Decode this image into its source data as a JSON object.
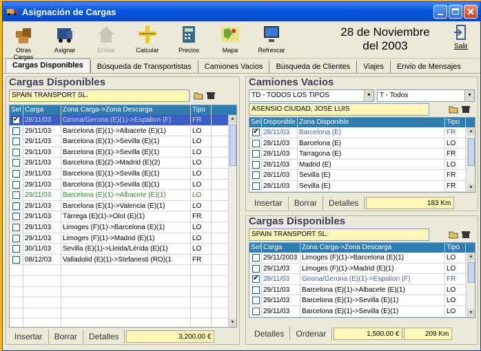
{
  "window": {
    "title": "Asignación de Cargas"
  },
  "toolbar": {
    "items": [
      {
        "label": "Otras Cargas",
        "icon": "boxes-icon"
      },
      {
        "label": "Asignar",
        "icon": "truck-icon"
      },
      {
        "label": "Enviar",
        "icon": "house-icon",
        "disabled": true
      },
      {
        "label": "Calcular",
        "icon": "ruler-icon"
      },
      {
        "label": "Precios",
        "icon": "calculator-icon"
      },
      {
        "label": "Mapa",
        "icon": "map-icon"
      },
      {
        "label": "Refrescar",
        "icon": "monitor-icon"
      }
    ],
    "date_line1": "28 de Noviembre",
    "date_line2": "del 2003",
    "exit_label": "Salir"
  },
  "tabs": [
    {
      "label": "Cargas Disponibles",
      "active": true
    },
    {
      "label": "Búsqueda de Transportistas"
    },
    {
      "label": "Camiones Vacios"
    },
    {
      "label": "Búsqueda de Clientes"
    },
    {
      "label": "Viajes"
    },
    {
      "label": "Envio de Mensajes"
    }
  ],
  "left_panel": {
    "title": "Cargas Disponibles",
    "company": "SPAIN TRANSPORT SL.",
    "columns": [
      "Sel",
      "Carga",
      "Zona Carga->Zona Descarga",
      "Tipo"
    ],
    "rows": [
      {
        "sel": true,
        "date": "28/11/03",
        "zone": "Girona/Gerona  (E)(1)->Espalion  (F)",
        "type": "FR",
        "style": "first"
      },
      {
        "sel": false,
        "date": "29/11/03",
        "zone": "Barcelona  (E)(1)->Albacete  (E)(1)",
        "type": "LO"
      },
      {
        "sel": false,
        "date": "29/11/03",
        "zone": "Barcelona  (E)(1)->Sevilla  (E)(1)",
        "type": "LO"
      },
      {
        "sel": false,
        "date": "29/11/03",
        "zone": "Barcelona  (E)(1)->Sevilla  (E)(1)",
        "type": "LO"
      },
      {
        "sel": false,
        "date": "29/11/03",
        "zone": "Barcelona  (E)(2)->Madrid  (E)(2)",
        "type": "LO"
      },
      {
        "sel": false,
        "date": "29/11/03",
        "zone": "Barcelona  (E)(1)->Sevilla  (E)(1)",
        "type": "LO"
      },
      {
        "sel": false,
        "date": "29/11/03",
        "zone": "Barcelona  (E)(1)->Sevilla  (E)(1)",
        "type": "LO"
      },
      {
        "sel": false,
        "date": "29/11/03",
        "zone": "Barcelona  (E)(1)->Albacete  (E)(1)",
        "type": "LO",
        "style": "hl"
      },
      {
        "sel": false,
        "date": "29/11/03",
        "zone": "Barcelona  (E)(1)->Valencia  (E)(1)",
        "type": "LO"
      },
      {
        "sel": false,
        "date": "29/11/03",
        "zone": "Tárrega  (E)(1)->Olot  (E)(1)",
        "type": "FR"
      },
      {
        "sel": false,
        "date": "29/11/03",
        "zone": "Limoges  (F)(1)->Barcelona  (E)(1)",
        "type": "LO"
      },
      {
        "sel": false,
        "date": "29/11/03",
        "zone": "Limoges  (F)(1)->Madrid  (E)(1)",
        "type": "LO"
      },
      {
        "sel": false,
        "date": "30/11/03",
        "zone": "Sevilla  (E)(1)->Lleida/Lérida  (E)(1)",
        "type": "LO"
      },
      {
        "sel": false,
        "date": "08/12/03",
        "zone": "Valladolid  (E)(1)->Stefanesti  (RO)(1",
        "type": "FR"
      }
    ],
    "buttons": {
      "insert": "Insertar",
      "delete": "Borrar",
      "details": "Detalles"
    },
    "total": "3,200.00 €"
  },
  "trucks_panel": {
    "title": "Camiones Vacios",
    "type_filter": "TD - TODOS LOS TIPOS",
    "t_filter": "T - Todos",
    "contact": "ASENSIO CIUDAD, JOSE LUIS",
    "columns": [
      "Sel",
      "Disponible",
      "Zona Disponible",
      "Tipo"
    ],
    "rows": [
      {
        "sel": true,
        "date": "28/11/03",
        "zone": "Barcelona  (E)",
        "type": "FR",
        "style": "sel"
      },
      {
        "sel": false,
        "date": "28/11/03",
        "zone": "Barcelona  (E)",
        "type": "LO"
      },
      {
        "sel": false,
        "date": "28/11/03",
        "zone": "Tarragona  (E)",
        "type": "FR"
      },
      {
        "sel": false,
        "date": "28/11/03",
        "zone": "Madrid  (E)",
        "type": "LO"
      },
      {
        "sel": false,
        "date": "28/11/03",
        "zone": "Sevilla  (E)",
        "type": "FR"
      },
      {
        "sel": false,
        "date": "28/11/03",
        "zone": "Sevilla  (E)",
        "type": "FR"
      }
    ],
    "buttons": {
      "insert": "Insertar",
      "delete": "Borrar",
      "details": "Detalles"
    },
    "distance": "183 Km"
  },
  "cargo_panel": {
    "title": "Cargas Disponibles",
    "company": "SPAIN TRANSPORT SL.",
    "columns": [
      "Sel",
      "Carga",
      "Zona Carga->Zona Descarga",
      "Tipo"
    ],
    "rows": [
      {
        "sel": false,
        "date": "29/11/2003",
        "zone": "Limoges  (F)(1)->Barcelona  (E)(1)",
        "type": "LO"
      },
      {
        "sel": false,
        "date": "29/11/03",
        "zone": "Limoges  (F)(1)->Madrid  (E)(1)",
        "type": "LO"
      },
      {
        "sel": true,
        "date": "28/11/03",
        "zone": "Girona/Gerona  (E)(1)->Espalion  (F)",
        "type": "FR",
        "style": "sel"
      },
      {
        "sel": false,
        "date": "29/11/03",
        "zone": "Barcelona  (E)(1)->Albacete  (E)(1)",
        "type": "LO"
      },
      {
        "sel": false,
        "date": "29/11/03",
        "zone": "Barcelona  (E)(1)->Sevilla  (E)(1)",
        "type": "LO"
      },
      {
        "sel": false,
        "date": "29/11/03",
        "zone": "Barcelona  (E)(1)->Sevilla  (E)(1)",
        "type": "LO"
      }
    ],
    "buttons": {
      "details": "Detalles",
      "order": "Ordenar"
    },
    "total": "1,500.00 €",
    "distance": "209 Km"
  }
}
